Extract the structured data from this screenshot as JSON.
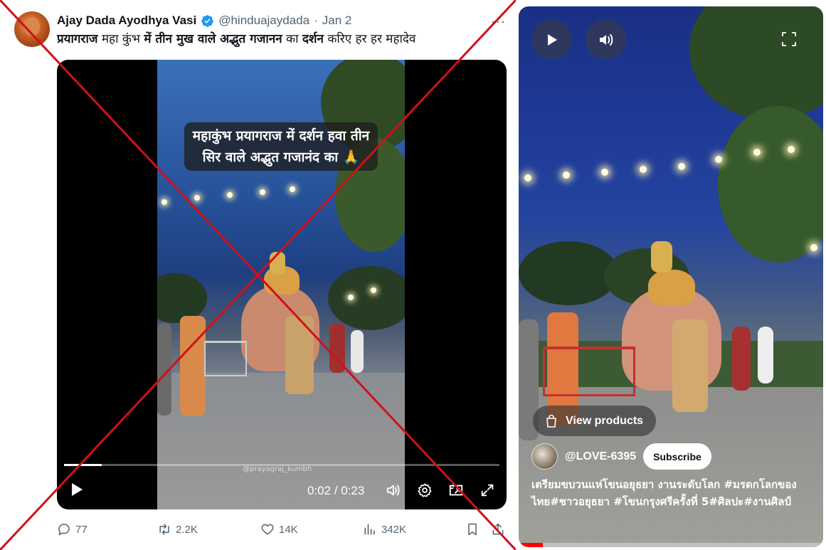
{
  "tweet": {
    "author_name": "Ajay Dada Ayodhya Vasi",
    "handle": "@hinduajaydada",
    "separator": "·",
    "date": "Jan 2",
    "more": "···",
    "text_segments": [
      {
        "t": "प्रयागराज",
        "b": true
      },
      {
        "t": " महा कुंभ ",
        "b": false
      },
      {
        "t": "में तीन मुख वाले अद्भुत गजानन",
        "b": true
      },
      {
        "t": " का ",
        "b": false
      },
      {
        "t": "दर्शन",
        "b": true
      },
      {
        "t": " करिए हर हर महादेव",
        "b": false
      }
    ],
    "video": {
      "caption_line1": "महाकुंभ प्रयागराज में दर्शन हवा तीन",
      "caption_line2": "सिर वाले अद्भुत गजानंद का 🙏",
      "watermark": "@prayagraj_kumbh",
      "time": "0:02 / 0:23",
      "progress_fraction": 0.087
    },
    "actions": {
      "replies": "77",
      "retweets": "2.2K",
      "likes": "14K",
      "views": "342K"
    }
  },
  "short": {
    "view_products_label": "View products",
    "channel_name": "@LOVE-6395",
    "subscribe_label": "Subscribe",
    "description": "เตรียมขบวนแห่โขนอยุธยา งานระดับโลก #มรดกโลกของไทย#ชาวอยุธยา #โขนกรุงศรีครั้งที่ 5#ศิลปะ#งานศิลป์",
    "progress_fraction": 0.08
  },
  "colors": {
    "cross": "#d0101a",
    "verified": "#1d9bf0",
    "muted": "#536471",
    "short_progress": "#ff0000"
  },
  "icons": [
    "verified-badge-icon",
    "play-icon",
    "volume-icon",
    "settings-gear-icon",
    "pip-icon",
    "expand-icon",
    "reply-icon",
    "retweet-icon",
    "like-heart-icon",
    "views-chart-icon",
    "bookmark-icon",
    "share-icon",
    "fullscreen-icon",
    "shopping-bag-icon"
  ]
}
